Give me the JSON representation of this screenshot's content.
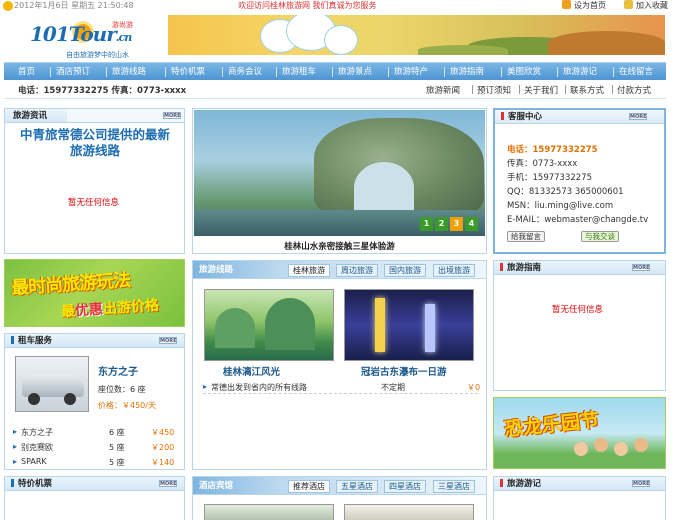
{
  "topbar": {
    "date": "2012年1月6日 星期五 21:50:48",
    "welcome": "欢迎访问桂林旅游网 我们真诚为您服务",
    "set_home": "设为首页",
    "add_fav": "加入收藏"
  },
  "logo": {
    "main": "101Tour",
    "suffix": ".cn",
    "tag": "游尚游",
    "slogan": "自由旅游梦中的山水"
  },
  "nav": [
    "首页",
    "酒店预订",
    "旅游线路",
    "特价机票",
    "商务会议",
    "旅游租车",
    "旅游景点",
    "旅游特产",
    "旅游指南",
    "美图欣赏",
    "旅游游记",
    "在线留言"
  ],
  "subnav": {
    "contact": "电话：15977332275  传真：0773-xxxx",
    "links": [
      "旅游新闻",
      "预订须知",
      "关于我们",
      "联系方式",
      "付款方式"
    ]
  },
  "more_label": "MORE",
  "news": {
    "title": "旅游资讯",
    "headline": "中青旅常德公司提供的最新旅游线路",
    "empty": "暂无任何信息"
  },
  "slideshow": {
    "caption": "桂林山水亲密接触三星体验游",
    "pages": [
      "1",
      "2",
      "3",
      "4"
    ],
    "active": 3
  },
  "service": {
    "title": "客服中心",
    "phone": "电话：15977332275",
    "fax": "传真：0773-xxxx",
    "mobile": "手机：15977332275",
    "qq": "QQ：81332573 365000601",
    "msn": "MSN：liu.ming@live.com",
    "email": "E-MAIL：webmaster@changde.tv",
    "btn_message": "给我留言",
    "btn_chat": "与我交谈"
  },
  "ad": {
    "line1": "最时尚旅游玩法",
    "line2a": "最",
    "line2b": "优惠",
    "line2c": "出游价格"
  },
  "routes": {
    "title": "旅游线路",
    "tabs": [
      "桂林旅游",
      "周边旅游",
      "国内旅游",
      "出境旅游"
    ],
    "items": [
      {
        "name": "桂林漓江风光"
      },
      {
        "name": "冠岩古东瀑布一日游"
      }
    ],
    "list": [
      {
        "name": "常德出发到省内的所有线路",
        "date": "不定期",
        "price": "￥0"
      }
    ]
  },
  "guide": {
    "title": "旅游指南",
    "empty": "暂无任何信息"
  },
  "cars": {
    "title": "租车服务",
    "featured": {
      "name": "东方之子",
      "seats": "座位数：6 座",
      "price": "价格：￥450/天"
    },
    "rows": [
      {
        "name": "东方之子",
        "seats": "6 座",
        "price": "￥450"
      },
      {
        "name": "别克赛欧",
        "seats": "5 座",
        "price": "￥200"
      },
      {
        "name": "SPARK",
        "seats": "5 座",
        "price": "￥140"
      }
    ]
  },
  "dino": {
    "text": "恐龙乐园节"
  },
  "flights": {
    "title": "特价机票"
  },
  "hotels": {
    "title": "酒店宾馆",
    "tabs": [
      "推荐酒店",
      "五星酒店",
      "四星酒店",
      "三星酒店"
    ]
  },
  "travelnotes": {
    "title": "旅游游记"
  },
  "colors": {
    "accent": "#4f95d2",
    "brand": "#1d6db3",
    "alert": "#e10000",
    "price": "#e07000"
  }
}
